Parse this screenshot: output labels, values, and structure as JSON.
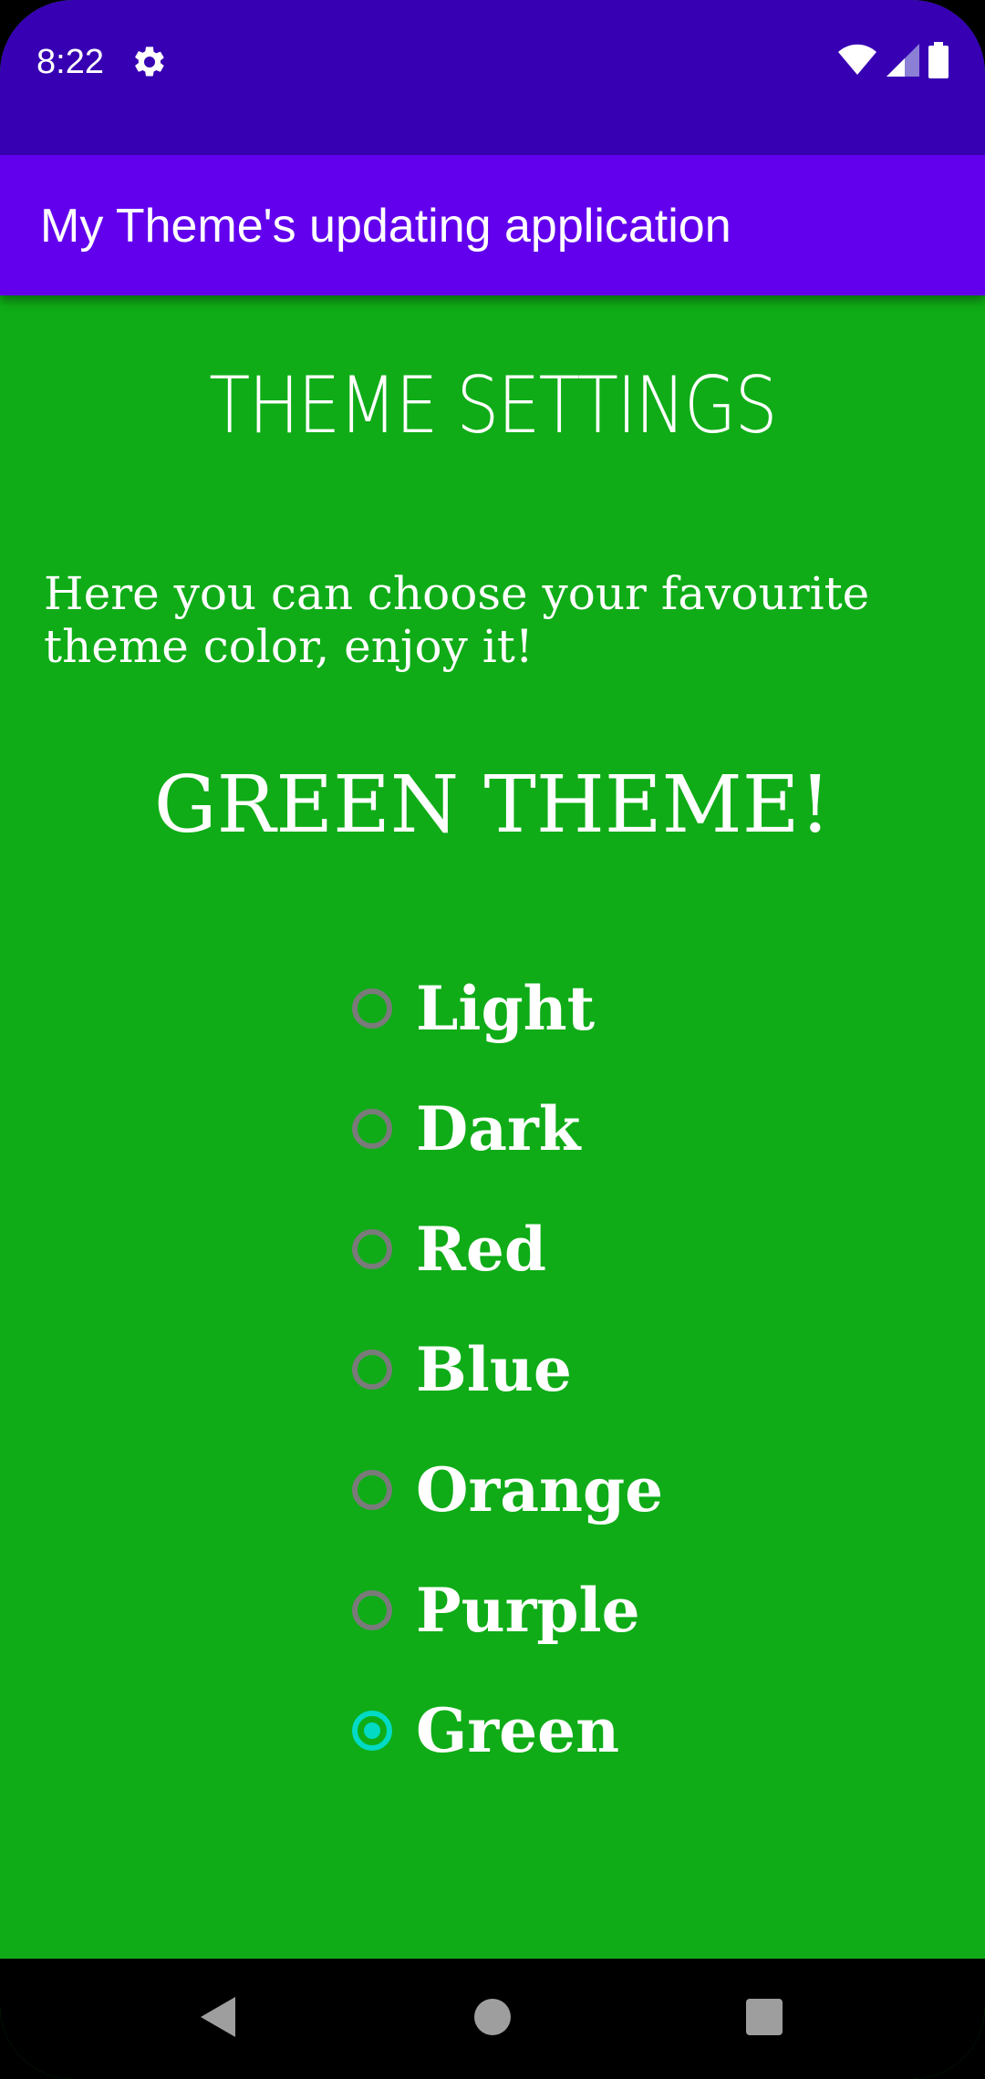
{
  "status_bar": {
    "time": "8:22",
    "background": "#3700B3",
    "icons": [
      "settings-icon",
      "wifi-icon",
      "signal-icon",
      "battery-icon"
    ]
  },
  "app_bar": {
    "title": "My Theme's updating application",
    "background": "#6200EE"
  },
  "content": {
    "background": "#0FAC17",
    "heading": "THEME SETTINGS",
    "intro": "Here you can choose your favourite theme color, enjoy it!",
    "current_theme": "GREEN THEME!"
  },
  "theme_options": {
    "items": [
      {
        "label": "Light",
        "checked": false
      },
      {
        "label": "Dark",
        "checked": false
      },
      {
        "label": "Red",
        "checked": false
      },
      {
        "label": "Blue",
        "checked": false
      },
      {
        "label": "Orange",
        "checked": false
      },
      {
        "label": "Purple",
        "checked": false
      },
      {
        "label": "Green",
        "checked": true
      }
    ],
    "selected": "Green",
    "accent": "#03DAC5"
  },
  "nav_bar": {
    "buttons": [
      "back-icon",
      "home-icon",
      "recents-icon"
    ]
  }
}
